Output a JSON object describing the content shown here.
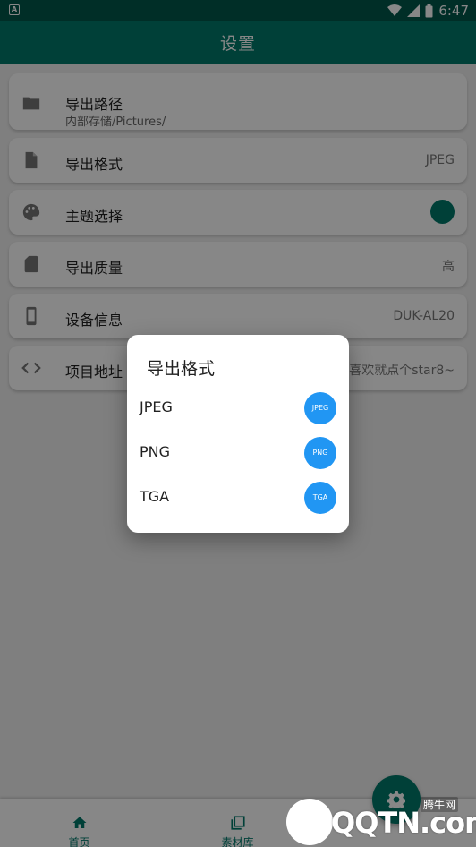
{
  "status_bar": {
    "time": "6:47",
    "battery": "6",
    "app_icon": "A"
  },
  "app_bar": {
    "title": "设置"
  },
  "settings": [
    {
      "title": "导出路径",
      "subtitle": "内部存储/Pictures/",
      "icon": "folder-icon"
    },
    {
      "title": "导出格式",
      "value": "JPEG",
      "icon": "file-icon"
    },
    {
      "title": "主题选择",
      "icon": "palette-icon",
      "theme_color": "#00796b"
    },
    {
      "title": "导出质量",
      "value": "高",
      "icon": "sd-card-icon"
    },
    {
      "title": "设备信息",
      "value": "DUK-AL20",
      "icon": "phone-icon"
    },
    {
      "title": "项目地址",
      "value": "喜欢就点个star8~",
      "icon": "code-icon"
    }
  ],
  "dialog": {
    "title": "导出格式",
    "options": [
      {
        "label": "JPEG",
        "badge": "JPEG"
      },
      {
        "label": "PNG",
        "badge": "PNG"
      },
      {
        "label": "TGA",
        "badge": "TGA"
      }
    ]
  },
  "bottom_nav": [
    {
      "label": "首页",
      "icon": "home-icon"
    },
    {
      "label": "素材库",
      "icon": "gallery-icon"
    }
  ],
  "fab": {
    "icon": "gear-icon"
  },
  "watermark": {
    "text": "QQTN.com",
    "small": "腾牛网"
  },
  "colors": {
    "primary": "#00796b",
    "primary_dark": "#00574b",
    "badge": "#2196f3"
  }
}
